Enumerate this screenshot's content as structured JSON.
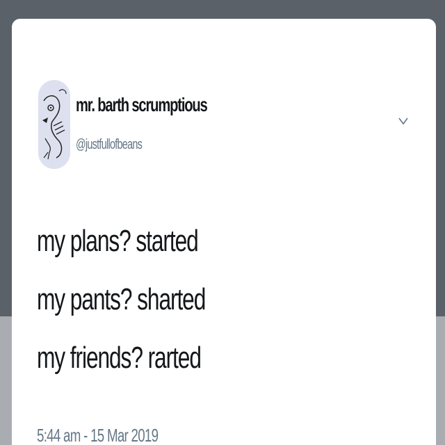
{
  "tweet": {
    "author": {
      "display_name": "mr. barth scrumptious",
      "handle": "@justfullofbeans",
      "avatar_icon": "bird-sketch-avatar"
    },
    "menu_icon": "chevron-down-icon",
    "lines": [
      "my plans? started",
      "my pants? sharted",
      "my friends? rarted"
    ],
    "timestamp": "5:44 am - 15 Mar 2019"
  },
  "colors": {
    "backdrop_dark": "#5b6168",
    "backdrop_light": "#a9adb1",
    "card": "#ffffff",
    "text_primary": "#14171a",
    "text_secondary": "#657786",
    "avatar_bg": "#dde1ef"
  }
}
